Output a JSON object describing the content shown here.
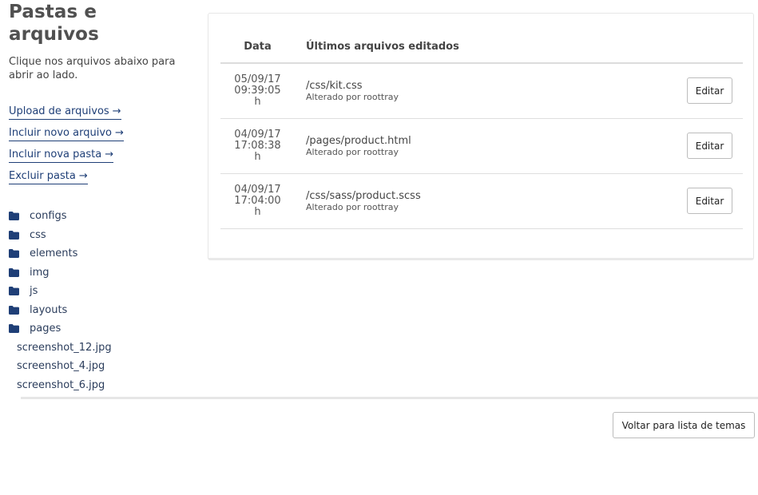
{
  "header": {
    "title": "Pastas e arquivos",
    "subtitle": "Clique nos arquivos abaixo para abrir ao lado."
  },
  "actions": [
    {
      "label": "Upload de arquivos",
      "arrow": "→"
    },
    {
      "label": "Incluir novo arquivo",
      "arrow": "→"
    },
    {
      "label": "Incluir nova pasta",
      "arrow": "→"
    },
    {
      "label": "Excluir pasta",
      "arrow": "→"
    }
  ],
  "tree": {
    "folders": [
      "configs",
      "css",
      "elements",
      "img",
      "js",
      "layouts",
      "pages"
    ],
    "files": [
      "screenshot_12.jpg",
      "screenshot_4.jpg",
      "screenshot_6.jpg"
    ]
  },
  "table": {
    "headers": {
      "date": "Data",
      "file": "Últimos arquivos editados"
    },
    "rows": [
      {
        "date_line1": "05/09/17",
        "date_line2": "09:39:05",
        "date_line3": "h",
        "path": "/css/kit.css",
        "meta": "Alterado por roottray",
        "button": "Editar"
      },
      {
        "date_line1": "04/09/17",
        "date_line2": "17:08:38",
        "date_line3": "h",
        "path": "/pages/product.html",
        "meta": "Alterado por roottray",
        "button": "Editar"
      },
      {
        "date_line1": "04/09/17",
        "date_line2": "17:04:00",
        "date_line3": "h",
        "path": "/css/sass/product.scss",
        "meta": "Alterado por roottray",
        "button": "Editar"
      }
    ]
  },
  "footer": {
    "back_label": "Voltar para lista de temas"
  },
  "icons": {
    "folder": "folder-icon",
    "arrow": "arrow-right-icon"
  },
  "colors": {
    "link": "#1f3f77",
    "folder": "#1f3f77",
    "title": "#505050"
  }
}
